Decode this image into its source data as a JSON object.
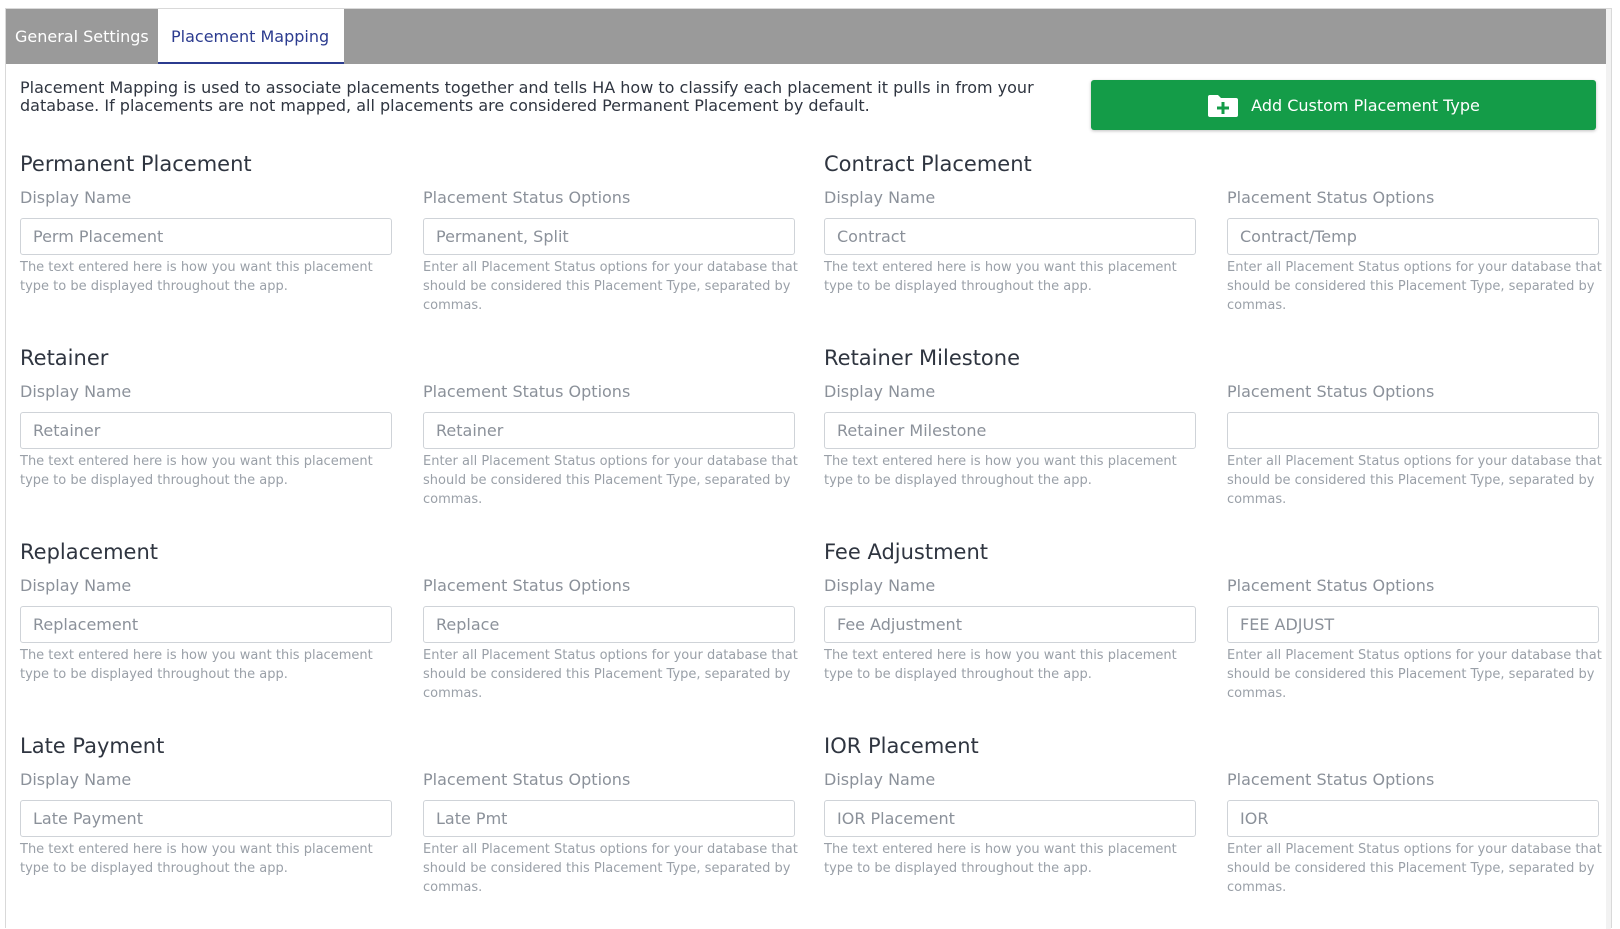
{
  "tabs": [
    {
      "label": "General Settings",
      "active": false
    },
    {
      "label": "Placement Mapping",
      "active": true
    }
  ],
  "intro_text": "Placement Mapping is used to associate placements together and tells HA how to classify each placement it pulls in from your database. If placements are not mapped, all placements are considered Permanent Placement by default.",
  "add_button": {
    "label": "Add Custom Placement Type",
    "icon": "folder-plus-icon",
    "color": "#149c48"
  },
  "labels": {
    "display_name": "Display Name",
    "status_options": "Placement Status Options",
    "display_help": "The text entered here is how you want this placement type to be displayed throughout the app.",
    "status_help": "Enter all Placement Status options for your database that should be considered this Placement Type, separated by commas."
  },
  "placements": [
    {
      "title": "Permanent Placement",
      "display_value": "Perm Placement",
      "status_value": "Permanent, Split"
    },
    {
      "title": "Contract Placement",
      "display_value": "Contract",
      "status_value": "Contract/Temp"
    },
    {
      "title": "Retainer",
      "display_value": "Retainer",
      "status_value": "Retainer"
    },
    {
      "title": "Retainer Milestone",
      "display_value": "Retainer Milestone",
      "status_value": ""
    },
    {
      "title": "Replacement",
      "display_value": "Replacement",
      "status_value": "Replace"
    },
    {
      "title": "Fee Adjustment",
      "display_value": "Fee Adjustment",
      "status_value": "FEE ADJUST"
    },
    {
      "title": "Late Payment",
      "display_value": "Late Payment",
      "status_value": "Late Pmt"
    },
    {
      "title": "IOR Placement",
      "display_value": "IOR Placement",
      "status_value": "IOR"
    }
  ]
}
